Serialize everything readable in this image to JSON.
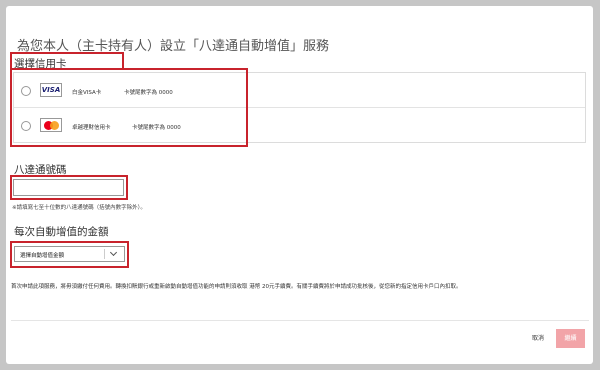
{
  "dialog": {
    "title": "為您本人（主卡持有人）設立「八達通自動增值」服務",
    "select_card_label": "選擇信用卡",
    "cards": [
      {
        "brand_icon": "visa-icon",
        "brand_text": "VISA",
        "name": "白金VISA卡",
        "last_digits_text": "卡號尾數字為 0000"
      },
      {
        "brand_icon": "mastercard-icon",
        "name": "卓越理財信用卡",
        "last_digits_text": "卡號尾數字為 0000"
      }
    ],
    "octopus_number_label": "八達通號碼",
    "octopus_number_value": "",
    "octopus_hint": "※請填寫七至十位數的八達通號碼（括號內數字除外）。",
    "amount_label": "每次自動增值的金額",
    "amount_select_value": "選擇自動增值金額",
    "notice": "首次申請此項服務，將毋須繳付任何費用。轉換扣賬銀行或重新啟動自動增值功能的申請則須收取 港幣 20元手續費。有關手續費將於申請成功批核後，從您新的指定信用卡戶口內扣取。",
    "cancel_label": "取消",
    "continue_label": "繼續"
  },
  "colors": {
    "highlight_border": "#c8232c",
    "continue_button": "#f2a4a8",
    "overlay_background": "#c6c6c6"
  }
}
